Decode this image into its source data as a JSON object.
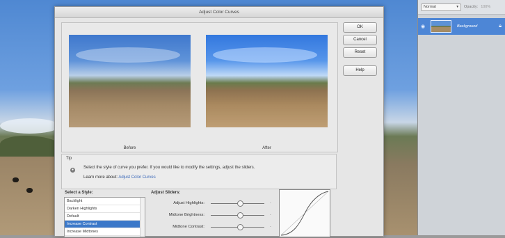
{
  "dialog": {
    "title": "Adjust Color Curves",
    "before_label": "Before",
    "after_label": "After",
    "buttons": {
      "ok": "OK",
      "cancel": "Cancel",
      "reset": "Reset",
      "help": "Help"
    }
  },
  "tip": {
    "title": "Tip",
    "text": "Select the style of curve you prefer. If you would like to modify the settings, adjust the sliders.",
    "learn_more": "Learn more about:",
    "link": "Adjust Color Curves"
  },
  "styles": {
    "label": "Select a Style:",
    "items": [
      "Backlight",
      "Darken Highlights",
      "Default",
      "Increase Contrast",
      "Increase Midtones"
    ],
    "selected": "Increase Contrast"
  },
  "sliders": {
    "label": "Adjust Sliders:",
    "items": [
      {
        "name": "Adjust Highlights:",
        "value": 0.55
      },
      {
        "name": "Midtone Brightness:",
        "value": 0.55
      },
      {
        "name": "Midtone Contrast:",
        "value": 0.55
      }
    ]
  },
  "layers_panel": {
    "blend_mode": "Normal",
    "opacity_label": "Opacity:",
    "opacity_value": "100%",
    "layer_name": "Background"
  },
  "icons": [
    "eye-icon",
    "lock-icon",
    "tip-icon",
    "chevron-down-icon"
  ],
  "colors": {
    "selection": "#3b78c9",
    "layer_highlight": "#4d86d6",
    "link": "#3a68b8"
  }
}
